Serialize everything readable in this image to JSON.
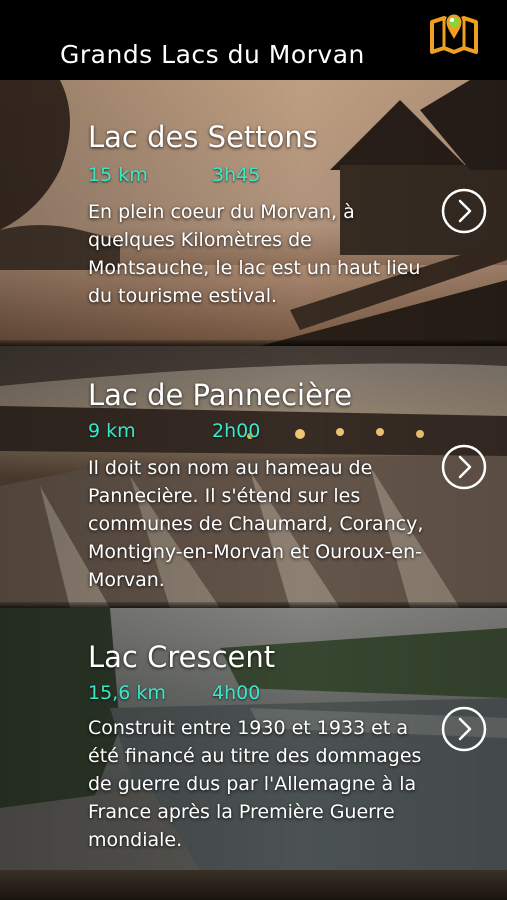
{
  "header": {
    "title": "Grands Lacs du Morvan",
    "map_icon": "map-pin-icon"
  },
  "lakes": [
    {
      "title": "Lac des Settons",
      "distance": "15 km",
      "duration": "3h45",
      "description": "En plein coeur du Morvan, à quelques Kilomètres de Montsauche, le lac est un haut lieu du tourisme estival."
    },
    {
      "title": "Lac de Pannecière",
      "distance": "9 km",
      "duration": "2h00",
      "description": "Il doit son nom au hameau de Pannecière. Il s'étend sur les communes de Chaumard, Corancy, Montigny-en-Morvan et Ouroux-en-Morvan."
    },
    {
      "title": "Lac Crescent",
      "distance": "15,6 km",
      "duration": "4h00",
      "description": "Construit entre 1930 et 1933 et a été financé au titre des dommages de guerre dus par l'Allemagne à la France après la Première Guerre mondiale."
    }
  ],
  "colors": {
    "accent": "#39e8c9",
    "map_icon_orange": "#f0a020",
    "map_icon_green": "#7ddc3a"
  }
}
